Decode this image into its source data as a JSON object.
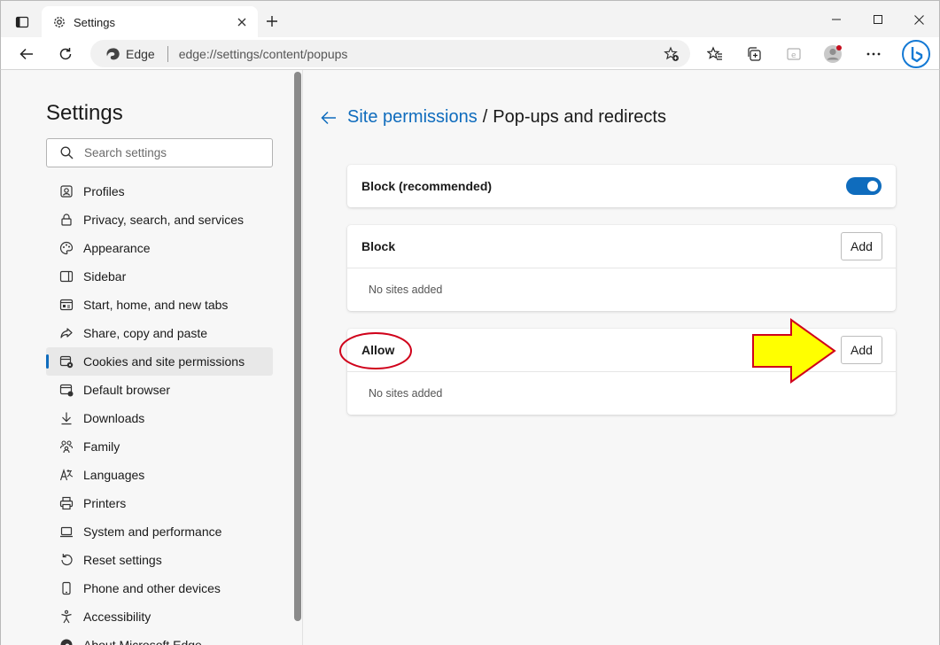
{
  "tab": {
    "title": "Settings",
    "icon": "gear-icon"
  },
  "address": {
    "identity": "Edge",
    "url": "edge://settings/content/popups"
  },
  "sidebar": {
    "title": "Settings",
    "search_placeholder": "Search settings",
    "items": [
      {
        "label": "Profiles",
        "icon": "profile-icon"
      },
      {
        "label": "Privacy, search, and services",
        "icon": "lock-icon"
      },
      {
        "label": "Appearance",
        "icon": "palette-icon"
      },
      {
        "label": "Sidebar",
        "icon": "sidebar-icon"
      },
      {
        "label": "Start, home, and new tabs",
        "icon": "home-tabs-icon"
      },
      {
        "label": "Share, copy and paste",
        "icon": "share-icon"
      },
      {
        "label": "Cookies and site permissions",
        "icon": "cookies-icon",
        "selected": true
      },
      {
        "label": "Default browser",
        "icon": "browser-icon"
      },
      {
        "label": "Downloads",
        "icon": "download-icon"
      },
      {
        "label": "Family",
        "icon": "family-icon"
      },
      {
        "label": "Languages",
        "icon": "languages-icon"
      },
      {
        "label": "Printers",
        "icon": "printer-icon"
      },
      {
        "label": "System and performance",
        "icon": "laptop-icon"
      },
      {
        "label": "Reset settings",
        "icon": "reset-icon"
      },
      {
        "label": "Phone and other devices",
        "icon": "phone-icon"
      },
      {
        "label": "Accessibility",
        "icon": "accessibility-icon"
      },
      {
        "label": "About Microsoft Edge",
        "icon": "edge-icon"
      }
    ]
  },
  "main": {
    "breadcrumb_parent": "Site permissions",
    "breadcrumb_separator": "/",
    "breadcrumb_current": "Pop-ups and redirects",
    "block_recommended": {
      "label": "Block (recommended)",
      "enabled": true
    },
    "block_list": {
      "label": "Block",
      "add_label": "Add",
      "empty_text": "No sites added"
    },
    "allow_list": {
      "label": "Allow",
      "add_label": "Add",
      "empty_text": "No sites added"
    }
  },
  "colors": {
    "accent": "#0f6cbd",
    "annotation_red": "#d0021b",
    "annotation_yellow": "#ffff00"
  }
}
